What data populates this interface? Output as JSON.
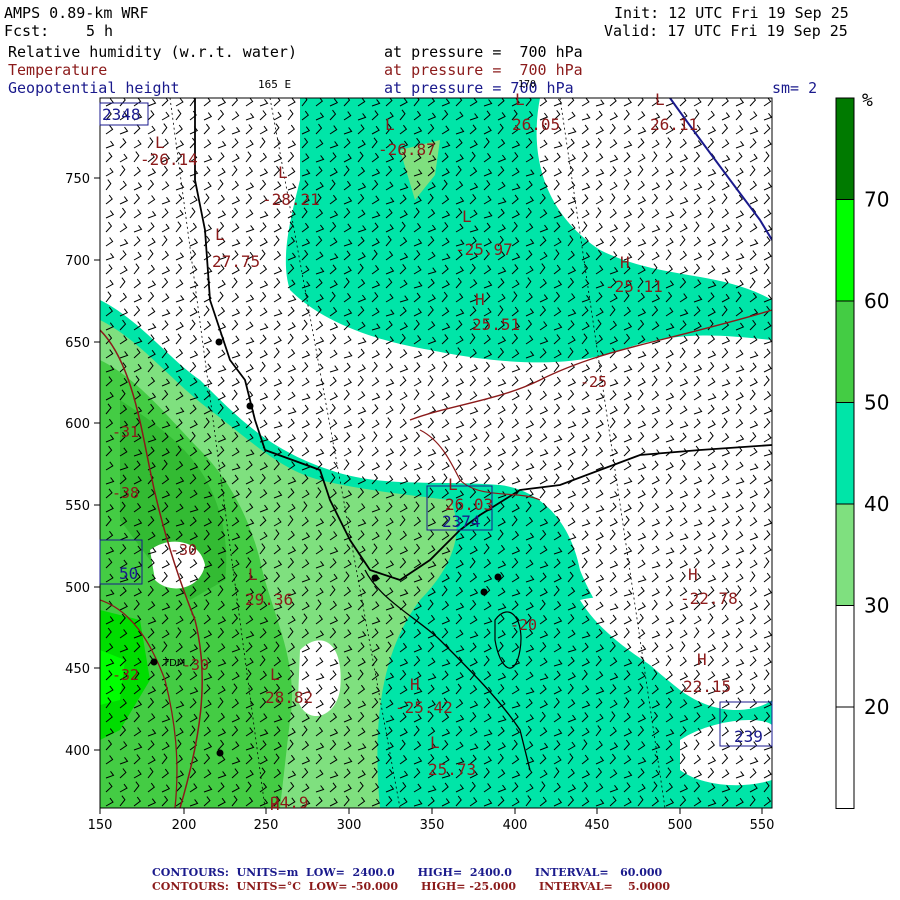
{
  "header": {
    "model": "AMPS 0.89-km WRF",
    "forecast_label": "Fcst:",
    "forecast_value": "5 h",
    "init": "Init: 12 UTC Fri 19 Sep 25",
    "valid": "Valid: 17 UTC Fri 19 Sep 25"
  },
  "fields": [
    {
      "name": "Relative humidity (w.r.t. water)",
      "level": "at pressure =  700 hPa",
      "color": "#000000"
    },
    {
      "name": "Temperature",
      "level": "at pressure =  700 hPa",
      "color": "#8b1a1a"
    },
    {
      "name": "Geopotential height",
      "level": "at pressure = 700 hPa",
      "color": "#1a1a8c"
    }
  ],
  "top_labels": {
    "lon_165e": "165 E",
    "lon_170": "170",
    "smoothing": "sm= 2"
  },
  "axes": {
    "x_ticks": [
      "150",
      "200",
      "250",
      "300",
      "350",
      "400",
      "450",
      "500",
      "550"
    ],
    "y_ticks": [
      "750",
      "700",
      "650",
      "600",
      "550",
      "500",
      "450",
      "400"
    ]
  },
  "colorbar": {
    "unit": "%",
    "tick_labels": [
      "70",
      "60",
      "50",
      "40",
      "30",
      "20"
    ],
    "colors": [
      "#ffffff",
      "#ffffff",
      "#7fe07f",
      "#00e5a8",
      "#44cc44",
      "#00ff00",
      "#007a00"
    ]
  },
  "map_labels": {
    "height_boxes": [
      "2348",
      "2374",
      "50",
      "239"
    ],
    "lows": [
      {
        "letter": "L",
        "value": "26.05"
      },
      {
        "letter": "L",
        "value": "26.11"
      },
      {
        "letter": "L",
        "value": "-26.87"
      },
      {
        "letter": "L",
        "value": "-26.14"
      },
      {
        "letter": "L",
        "value": "-28.21"
      },
      {
        "letter": "L",
        "value": "-25.97"
      },
      {
        "letter": "L",
        "value": "27.75"
      },
      {
        "letter": "L",
        "value": "29.36"
      },
      {
        "letter": "L",
        "value": "28.82"
      },
      {
        "letter": "L",
        "value": "25.73"
      },
      {
        "letter": "L",
        "value": "26.03"
      }
    ],
    "highs": [
      {
        "letter": "H",
        "value": "-25.11"
      },
      {
        "letter": "H",
        "value": "25.51"
      },
      {
        "letter": "H",
        "value": "-22.78"
      },
      {
        "letter": "H",
        "value": "22.15"
      },
      {
        "letter": "H",
        "value": "-25.42"
      },
      {
        "letter": "H",
        "value": "24.9"
      }
    ],
    "contour_values": [
      "-25",
      "-31",
      "-38",
      "-30",
      "-32",
      "-30",
      "-20"
    ],
    "station": "TDM"
  },
  "footer": {
    "line1": "CONTOURS:  UNITS=m  LOW=  2400.0      HIGH=  2400.0      INTERVAL=   60.000",
    "line2": "CONTOURS:  UNITS=°C  LOW= -50.000      HIGH= -25.000      INTERVAL=    5.0000"
  }
}
